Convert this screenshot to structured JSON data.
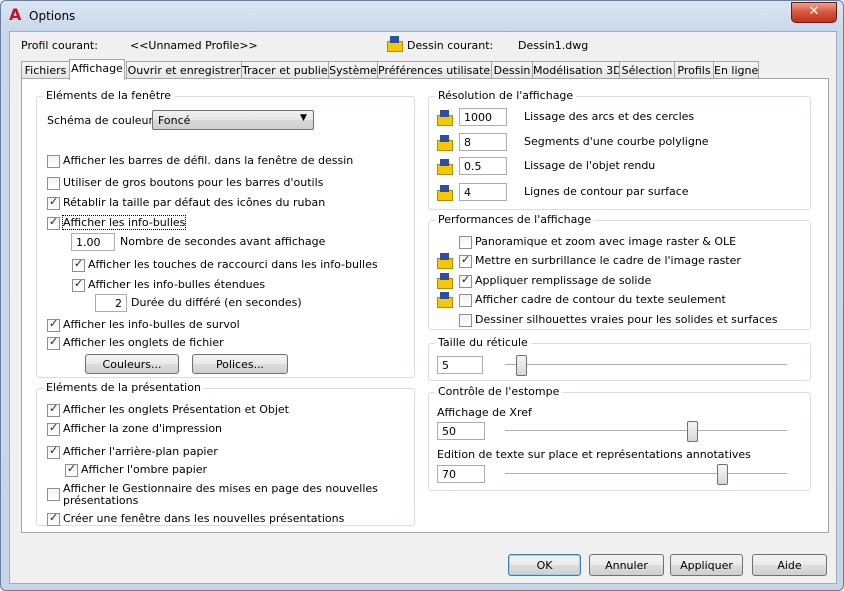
{
  "window": {
    "title": "Options",
    "close_label": "✕"
  },
  "header": {
    "profile_label": "Profil courant:",
    "profile_value": "<<Unnamed Profile>>",
    "drawing_label": "Dessin courant:",
    "drawing_value": "Dessin1.dwg"
  },
  "tabs": [
    "Fichiers",
    "Affichage",
    "Ouvrir et enregistrer",
    "Tracer et publier",
    "Système",
    "Préférences utilisateur",
    "Dessin",
    "Modélisation 3D",
    "Sélection",
    "Profils",
    "En ligne"
  ],
  "window_elements": {
    "title": "Eléments de la fenêtre",
    "color_scheme_label": "Schéma de couleurs:",
    "color_scheme_value": "Foncé",
    "items": [
      {
        "label": "Afficher les barres de défil. dans la fenêtre de dessin",
        "checked": false
      },
      {
        "label": "Utiliser de gros boutons pour les barres d'outils",
        "checked": false
      },
      {
        "label": "Rétablir la taille par défaut des icônes du ruban",
        "checked": true
      },
      {
        "label": "Afficher les info-bulles",
        "checked": true
      }
    ],
    "seconds_value": "1.00",
    "seconds_label": "Nombre de secondes avant affichage",
    "shortcut_label": "Afficher les touches de raccourci dans les info-bulles",
    "extended_label": "Afficher les info-bulles étendues",
    "delay_value": "2",
    "delay_label": "Durée du différé (en secondes)",
    "rollover_label": "Afficher les info-bulles de survol",
    "filetabs_label": "Afficher les onglets de fichier",
    "colors_button": "Couleurs...",
    "fonts_button": "Polices..."
  },
  "layout_elements": {
    "title": "Eléments de la présentation",
    "items": [
      {
        "label": "Afficher les onglets Présentation et Objet",
        "checked": true
      },
      {
        "label": "Afficher la zone d'impression",
        "checked": true
      },
      {
        "label": "Afficher l'arrière-plan papier",
        "checked": true
      },
      {
        "label": "Afficher l'ombre papier",
        "checked": true
      },
      {
        "label": "Afficher le Gestionnaire des mises en page des nouvelles",
        "label2": "présentations",
        "checked": false
      },
      {
        "label": "Créer une fenêtre dans les nouvelles présentations",
        "checked": true
      }
    ]
  },
  "resolution": {
    "title": "Résolution de l'affichage",
    "rows": [
      {
        "value": "1000",
        "label": "Lissage des arcs et des cercles"
      },
      {
        "value": "8",
        "label": "Segments d'une courbe polyligne"
      },
      {
        "value": "0.5",
        "label": "Lissage de l'objet rendu"
      },
      {
        "value": "4",
        "label": "Lignes de contour par surface"
      }
    ]
  },
  "performance": {
    "title": "Performances de l'affichage",
    "items": [
      {
        "label": "Panoramique et zoom avec image raster & OLE",
        "checked": false,
        "icon": false
      },
      {
        "label": "Mettre en surbrillance le cadre de l'image raster",
        "checked": true,
        "icon": true
      },
      {
        "label": "Appliquer remplissage de solide",
        "checked": true,
        "icon": true
      },
      {
        "label": "Afficher cadre de contour du texte seulement",
        "checked": false,
        "icon": true
      },
      {
        "label": "Dessiner silhouettes vraies pour les solides et surfaces",
        "checked": false,
        "icon": false
      }
    ]
  },
  "crosshair": {
    "title": "Taille du réticule",
    "value": "5",
    "level_percent": 5
  },
  "fade": {
    "title": "Contrôle de l'estompe",
    "xref_label": "Affichage de Xref",
    "xref_value": "50",
    "xref_level_percent": 50,
    "inplace_label": "Edition de texte sur place et représentations annotatives",
    "inplace_value": "70",
    "inplace_level_percent": 70
  },
  "footer": {
    "ok": "OK",
    "cancel": "Annuler",
    "apply": "Appliquer",
    "help": "Aide"
  }
}
